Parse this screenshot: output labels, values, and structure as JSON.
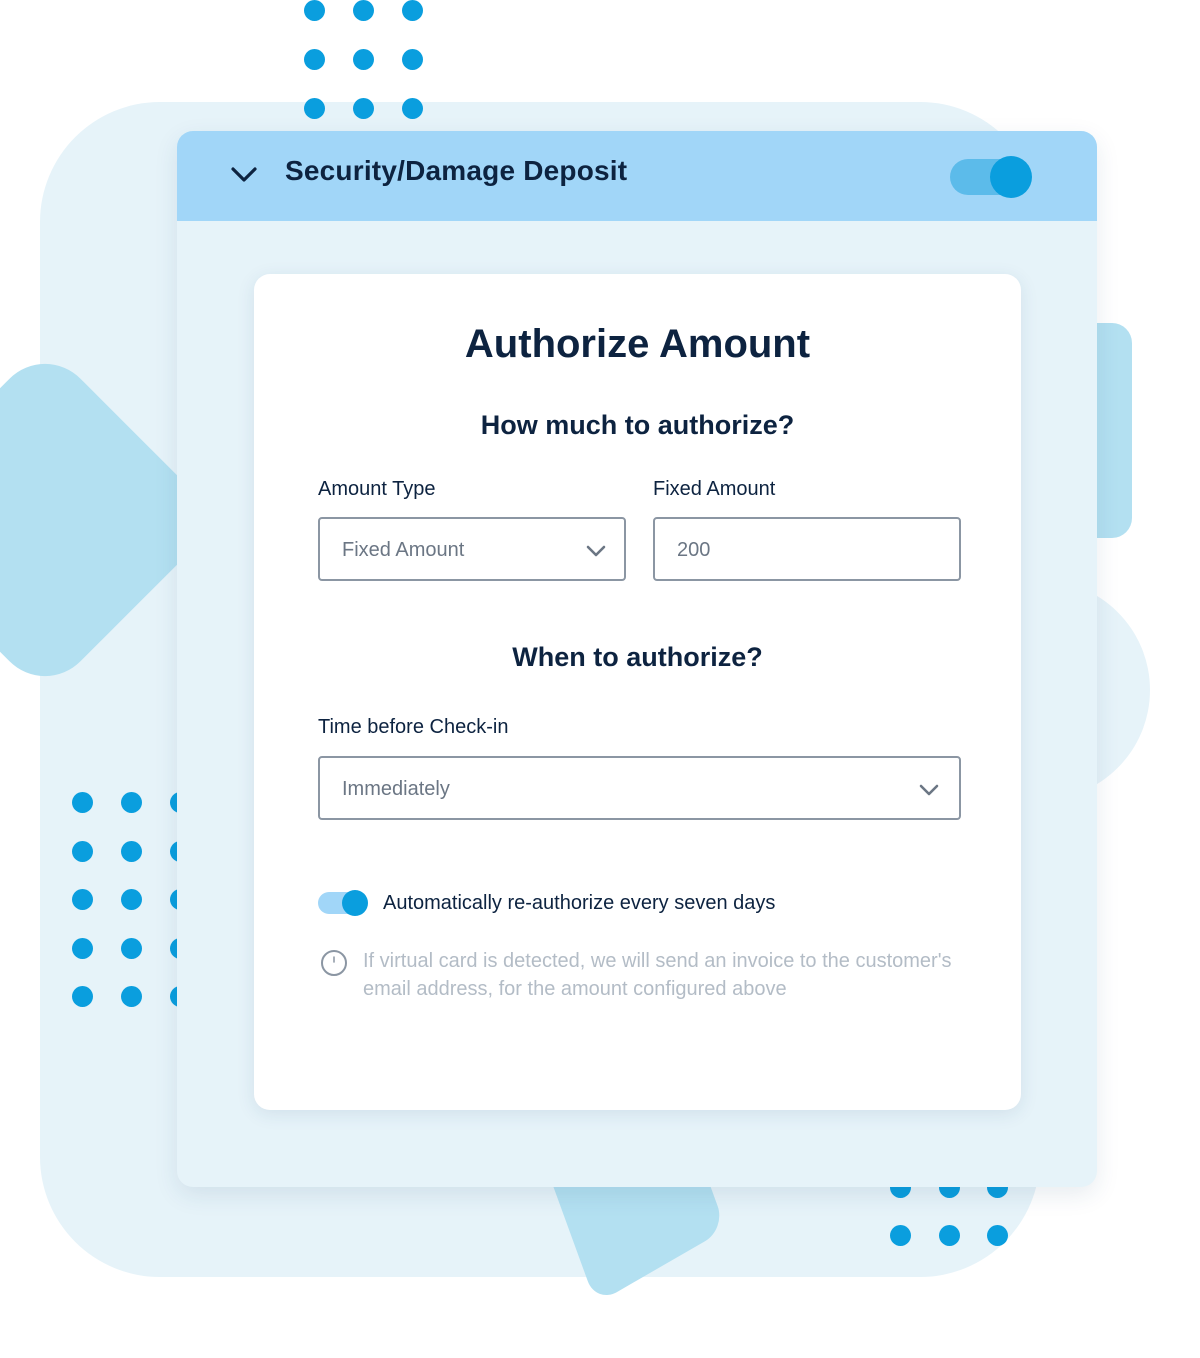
{
  "header": {
    "title": "Security/Damage Deposit",
    "collapse_icon": "chevron-down-icon",
    "toggle_on": true
  },
  "card": {
    "title": "Authorize Amount",
    "how_much_heading": "How much to authorize?",
    "amount_type": {
      "label": "Amount Type",
      "value": "Fixed Amount",
      "icon": "chevron-down-icon"
    },
    "fixed_amount": {
      "label": "Fixed Amount",
      "value": "200"
    },
    "when_heading": "When to authorize?",
    "time_before_checkin": {
      "label": "Time before Check-in",
      "value": "Immediately",
      "icon": "chevron-down-icon"
    },
    "reauthorize": {
      "label": "Automatically re-authorize every seven days",
      "enabled": true
    },
    "info": {
      "icon": "info-icon",
      "text": "If virtual card is detected, we will send an invoice to the customer's email address, for the amount configured above"
    }
  },
  "colors": {
    "accent": "#0a9ede",
    "header_bg": "#a1d6f8",
    "panel_bg": "#e6f3f9",
    "text_dark": "#0d2340",
    "muted": "#b3bcc6"
  }
}
